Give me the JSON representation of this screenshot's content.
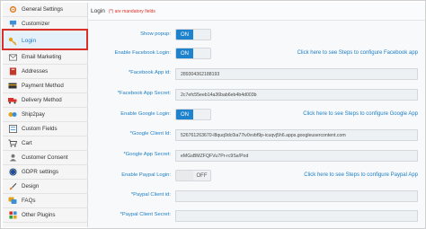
{
  "sidebar": {
    "items": [
      {
        "label": "General Settings",
        "icon": "gear-icon"
      },
      {
        "label": "Customizer",
        "icon": "paint-icon"
      },
      {
        "label": "Login",
        "icon": "key-icon",
        "active": true
      },
      {
        "label": "Email Marketing",
        "icon": "envelope-icon"
      },
      {
        "label": "Addresses",
        "icon": "address-book-icon"
      },
      {
        "label": "Payment Method",
        "icon": "credit-card-icon"
      },
      {
        "label": "Delivery Method",
        "icon": "truck-icon"
      },
      {
        "label": "Ship2pay",
        "icon": "ship2pay-icon"
      },
      {
        "label": "Custom Fields",
        "icon": "custom-fields-icon"
      },
      {
        "label": "Cart",
        "icon": "cart-icon"
      },
      {
        "label": "Customer Consent",
        "icon": "customer-consent-icon"
      },
      {
        "label": "GDPR settings",
        "icon": "gdpr-icon"
      },
      {
        "label": "Design",
        "icon": "design-brush-icon"
      },
      {
        "label": "FAQs",
        "icon": "faq-icon"
      },
      {
        "label": "Other Plugins",
        "icon": "plugins-icon"
      }
    ]
  },
  "panel": {
    "title": "Login",
    "mandatory_note": "(*) are mandatory fields"
  },
  "form": {
    "show_popup": {
      "label": "Show popup:",
      "state": "ON"
    },
    "enable_facebook": {
      "label": "Enable Facebook Login:",
      "state": "ON",
      "link": "Click here to see Steps to configure Facebook app"
    },
    "facebook_app_id": {
      "label": "*Facebook App id:",
      "value": "289304362188193"
    },
    "facebook_app_secret": {
      "label": "*Facebook App Secret:",
      "value": "2c7efc55eeb14a36bab6eb4b4d003b"
    },
    "enable_google": {
      "label": "Enable Google Login:",
      "state": "ON",
      "link": "Click here to see Steps to configure Google App"
    },
    "google_client_id": {
      "label": "*Google Client Id:",
      "value": "526761263670-l8quq9dc0ia77iv0vvbf9p-icuqvj5h6.apps.googleusercontent.com"
    },
    "google_app_secret": {
      "label": "*Google App Secret:",
      "value": "eMGsBMZFQFVu7Pr-rc9Sa!Pod"
    },
    "enable_paypal": {
      "label": "Enable Paypal Login:",
      "state": "OFF",
      "link": "Click here to see Steps to configure Paypal App"
    },
    "paypal_client_id": {
      "label": "*Paypal Client id:",
      "value": ""
    },
    "paypal_client_secret": {
      "label": "*Paypal Client Secret:",
      "value": ""
    }
  },
  "colors": {
    "accent": "#1f82cc",
    "link": "#1d7ec4",
    "mandatory": "#d9302a",
    "highlight_outline": "#d9302a"
  }
}
